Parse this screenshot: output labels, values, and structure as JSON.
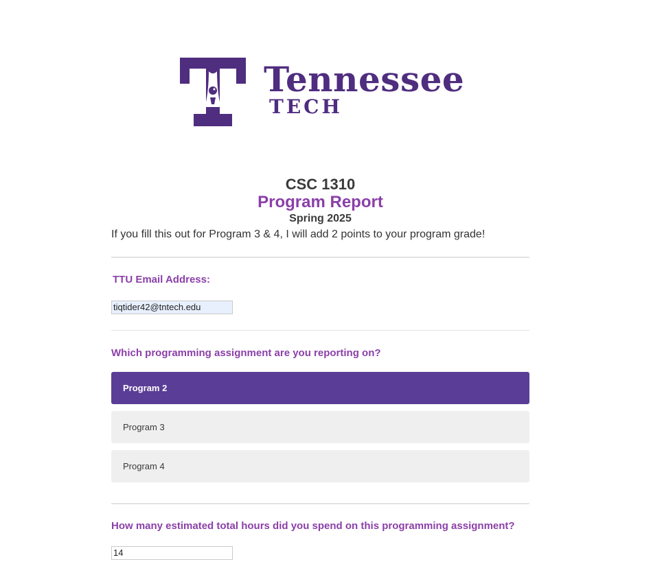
{
  "logo": {
    "line1": "Tennessee",
    "line2": "TECH",
    "brand_color": "#4f2d7f"
  },
  "header": {
    "course": "CSC 1310",
    "title": "Program Report",
    "term": "Spring 2025"
  },
  "intro": "If you fill this out for Program 3 & 4, I will add 2 points to your program grade!",
  "questions": {
    "email": {
      "label": "TTU Email Address:",
      "value": "tiqtider42@tntech.edu"
    },
    "assignment": {
      "label": "Which programming assignment are you reporting on?",
      "options": [
        "Program 2",
        "Program 3",
        "Program 4"
      ],
      "selected": "Program 2"
    },
    "hours": {
      "label": "How many estimated total hours did you spend on this programming assignment?",
      "value": "14"
    }
  },
  "colors": {
    "accent": "#8b3fa8",
    "selected_option": "#5a3d96",
    "option_bg": "#efefef"
  }
}
